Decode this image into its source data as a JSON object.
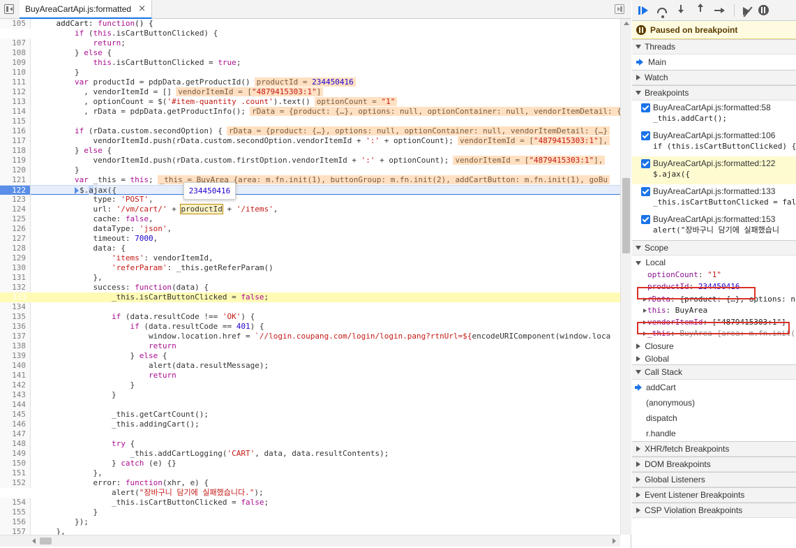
{
  "editor": {
    "tab_label": "BuyAreaCartApi.js:formatted",
    "tab_close": "×",
    "popover_value": "234450416",
    "lines": [
      {
        "no": "105",
        "bp": false,
        "cls": "",
        "html": "    <span class='c'>addCart: </span><span class='k'>function</span><span class='c'>() {</span>"
      },
      {
        "no": "106",
        "bp": true,
        "cls": "",
        "html": "        <span class='k'>if</span> (<span class='k'>this</span>.isCartButtonClicked) {"
      },
      {
        "no": "107",
        "bp": false,
        "cls": "",
        "html": "            <span class='k'>return</span>;"
      },
      {
        "no": "108",
        "bp": false,
        "cls": "",
        "html": "        } <span class='k'>else</span> {"
      },
      {
        "no": "109",
        "bp": false,
        "cls": "",
        "html": "            <span class='k'>this</span>.isCartButtonClicked = <span class='k'>true</span>;"
      },
      {
        "no": "110",
        "bp": false,
        "cls": "",
        "html": "        }"
      },
      {
        "no": "111",
        "bp": false,
        "cls": "",
        "html": "        <span class='k'>var</span> productId = pdpData.getProductId()<span class='inline-val'>productId = <span class='n'>234450416</span></span>"
      },
      {
        "no": "112",
        "bp": false,
        "cls": "",
        "html": "          , vendorItemId = []<span class='inline-val'>vendorItemId = [<span class='s'>\"4879415303:1\"</span>]</span>"
      },
      {
        "no": "113",
        "bp": false,
        "cls": "",
        "html": "          , optionCount = $(<span class='s'>'#item-quantity .count'</span>).text()<span class='inline-val'>optionCount = <span class='s'>\"1\"</span></span>"
      },
      {
        "no": "114",
        "bp": false,
        "cls": "",
        "html": "          , rData = pdpData.getProductInfo();<span class='inline-val'>rData = {product: {…}, options: null, optionContainer: null, vendorItemDetail: {…}</span>"
      },
      {
        "no": "115",
        "bp": false,
        "cls": "",
        "html": ""
      },
      {
        "no": "116",
        "bp": false,
        "cls": "",
        "html": "        <span class='k'>if</span> (rData.custom.secondOption) {<span class='inline-val'>rData = {product: {…}, options: null, optionContainer: null, vendorItemDetail: {…}</span>"
      },
      {
        "no": "117",
        "bp": false,
        "cls": "",
        "html": "            vendorItemId.push(rData.custom.secondOption.vendorItemId + <span class='s'>':'</span> + optionCount);<span class='inline-val'>vendorItemId = [<span class='s'>\"4879415303:1\"</span>],</span>"
      },
      {
        "no": "118",
        "bp": false,
        "cls": "",
        "html": "        } <span class='k'>else</span> {"
      },
      {
        "no": "119",
        "bp": false,
        "cls": "",
        "html": "            vendorItemId.push(rData.custom.firstOption.vendorItemId + <span class='s'>':'</span> + optionCount);<span class='inline-val'>vendorItemId = [<span class='s'>\"4879415303:1\"</span>],</span>"
      },
      {
        "no": "120",
        "bp": false,
        "cls": "",
        "html": "        }"
      },
      {
        "no": "121",
        "bp": false,
        "cls": "",
        "html": "        <span class='k'>var</span> _this = <span class='k'>this</span>;<span class='inline-val'>_this = BuyArea {area: m.fn.init(1), buttonGroup: m.fn.init(2), addCartButton: m.fn.init(1), goBu</span>"
      },
      {
        "no": "122",
        "bp": true,
        "cls": "paused",
        "html": "        <span class='step-marker'></span>$.<span style='background:#c7d8f8'>a</span>jax({"
      },
      {
        "no": "123",
        "bp": false,
        "cls": "",
        "html": "            type: <span class='s'>'POST'</span>,"
      },
      {
        "no": "124",
        "bp": false,
        "cls": "",
        "html": "            url: <span class='s'>'/vm/cart/'</span> + <span class='word-box'>productId</span> + <span class='s'>'/items'</span>,"
      },
      {
        "no": "125",
        "bp": false,
        "cls": "",
        "html": "            cache: <span class='k'>false</span>,"
      },
      {
        "no": "126",
        "bp": false,
        "cls": "",
        "html": "            dataType: <span class='s'>'json'</span>,"
      },
      {
        "no": "127",
        "bp": false,
        "cls": "",
        "html": "            timeout: <span class='n'>7000</span>,"
      },
      {
        "no": "128",
        "bp": false,
        "cls": "",
        "html": "            data: {"
      },
      {
        "no": "129",
        "bp": false,
        "cls": "",
        "html": "                <span class='s'>'items'</span>: vendorItemId,"
      },
      {
        "no": "130",
        "bp": false,
        "cls": "",
        "html": "                <span class='s'>'referParam'</span>: _this.getReferParam()"
      },
      {
        "no": "131",
        "bp": false,
        "cls": "",
        "html": "            },"
      },
      {
        "no": "132",
        "bp": false,
        "cls": "",
        "html": "            success: <span class='k'>function</span>(data) {"
      },
      {
        "no": "133",
        "bp": true,
        "cls": "hl-yellow",
        "html": "                _this.isCartButtonClicked = <span class='k'>false</span>;"
      },
      {
        "no": "134",
        "bp": false,
        "cls": "",
        "html": ""
      },
      {
        "no": "135",
        "bp": false,
        "cls": "",
        "html": "                <span class='k'>if</span> (data.resultCode !== <span class='s'>'OK'</span>) {"
      },
      {
        "no": "136",
        "bp": false,
        "cls": "",
        "html": "                    <span class='k'>if</span> (data.resultCode == <span class='n'>401</span>) {"
      },
      {
        "no": "137",
        "bp": false,
        "cls": "",
        "html": "                        window.location.href = <span class='s'>`//login.coupang.com/login/login.pang?rtnUrl=${</span>encodeURIComponent(window.loca"
      },
      {
        "no": "138",
        "bp": false,
        "cls": "",
        "html": "                        <span class='k'>return</span>"
      },
      {
        "no": "139",
        "bp": false,
        "cls": "",
        "html": "                    } <span class='k'>else</span> {"
      },
      {
        "no": "140",
        "bp": false,
        "cls": "",
        "html": "                        alert(data.resultMessage);"
      },
      {
        "no": "141",
        "bp": false,
        "cls": "",
        "html": "                        <span class='k'>return</span>"
      },
      {
        "no": "142",
        "bp": false,
        "cls": "",
        "html": "                    }"
      },
      {
        "no": "143",
        "bp": false,
        "cls": "",
        "html": "                }"
      },
      {
        "no": "144",
        "bp": false,
        "cls": "",
        "html": ""
      },
      {
        "no": "145",
        "bp": false,
        "cls": "",
        "html": "                _this.getCartCount();"
      },
      {
        "no": "146",
        "bp": false,
        "cls": "",
        "html": "                _this.addingCart();"
      },
      {
        "no": "147",
        "bp": false,
        "cls": "",
        "html": ""
      },
      {
        "no": "148",
        "bp": false,
        "cls": "",
        "html": "                <span class='k'>try</span> {"
      },
      {
        "no": "149",
        "bp": false,
        "cls": "",
        "html": "                    _this.addCartLogging(<span class='s'>'CART'</span>, data, data.resultContents);"
      },
      {
        "no": "150",
        "bp": false,
        "cls": "",
        "html": "                } <span class='k'>catch</span> (e) {}"
      },
      {
        "no": "151",
        "bp": false,
        "cls": "",
        "html": "            },"
      },
      {
        "no": "152",
        "bp": false,
        "cls": "",
        "html": "            error: <span class='k'>function</span>(xhr, e) {"
      },
      {
        "no": "153",
        "bp": true,
        "cls": "",
        "html": "                alert(<span class='s'>\"장바구니 담기에 실패했습니다.\"</span>);"
      },
      {
        "no": "154",
        "bp": false,
        "cls": "",
        "html": "                _this.isCartButtonClicked = <span class='k'>false</span>;"
      },
      {
        "no": "155",
        "bp": false,
        "cls": "",
        "html": "            }"
      },
      {
        "no": "156",
        "bp": false,
        "cls": "",
        "html": "        });"
      },
      {
        "no": "157",
        "bp": false,
        "cls": "",
        "html": "    },"
      },
      {
        "no": "158",
        "bp": false,
        "cls": "",
        "html": ""
      }
    ]
  },
  "sidebar": {
    "paused_label": "Paused on breakpoint",
    "threads_header": "Threads",
    "thread_main": "Main",
    "watch_header": "Watch",
    "breakpoints_header": "Breakpoints",
    "breakpoints": [
      {
        "file": "BuyAreaCartApi.js:formatted:58",
        "code": "_this.addCart();",
        "active": false
      },
      {
        "file": "BuyAreaCartApi.js:formatted:106",
        "code": "if (this.isCartButtonClicked) {",
        "active": false
      },
      {
        "file": "BuyAreaCartApi.js:formatted:122",
        "code": "$.ajax({",
        "active": true
      },
      {
        "file": "BuyAreaCartApi.js:formatted:133",
        "code": "_this.isCartButtonClicked = fal",
        "active": false
      },
      {
        "file": "BuyAreaCartApi.js:formatted:153",
        "code": "alert(\"장바구니 담기에 실패했습니",
        "active": false
      }
    ],
    "scope_header": "Scope",
    "scope_local": "Local",
    "scope": {
      "optionCount_name": "optionCount",
      "optionCount_val": "\"1\"",
      "productId_name": "productId",
      "productId_val": "234450416",
      "rData_name": "rData",
      "rData_val": "{product: {…}, options: n",
      "this_name": "this",
      "this_val": "BuyArea",
      "vendorItemId_name": "vendorItemId",
      "vendorItemId_val": "[\"4879415303:1\"]",
      "_this_name": "_this",
      "_this_val": "BuyArea {area: m.fn.init("
    },
    "scope_closure": "Closure",
    "scope_global": "Global",
    "callstack_header": "Call Stack",
    "callstack": [
      "addCart",
      "(anonymous)",
      "dispatch",
      "r.handle"
    ],
    "xhr_header": "XHR/fetch Breakpoints",
    "dom_header": "DOM Breakpoints",
    "global_listeners_header": "Global Listeners",
    "event_listener_header": "Event Listener Breakpoints",
    "csp_header": "CSP Violation Breakpoints"
  }
}
